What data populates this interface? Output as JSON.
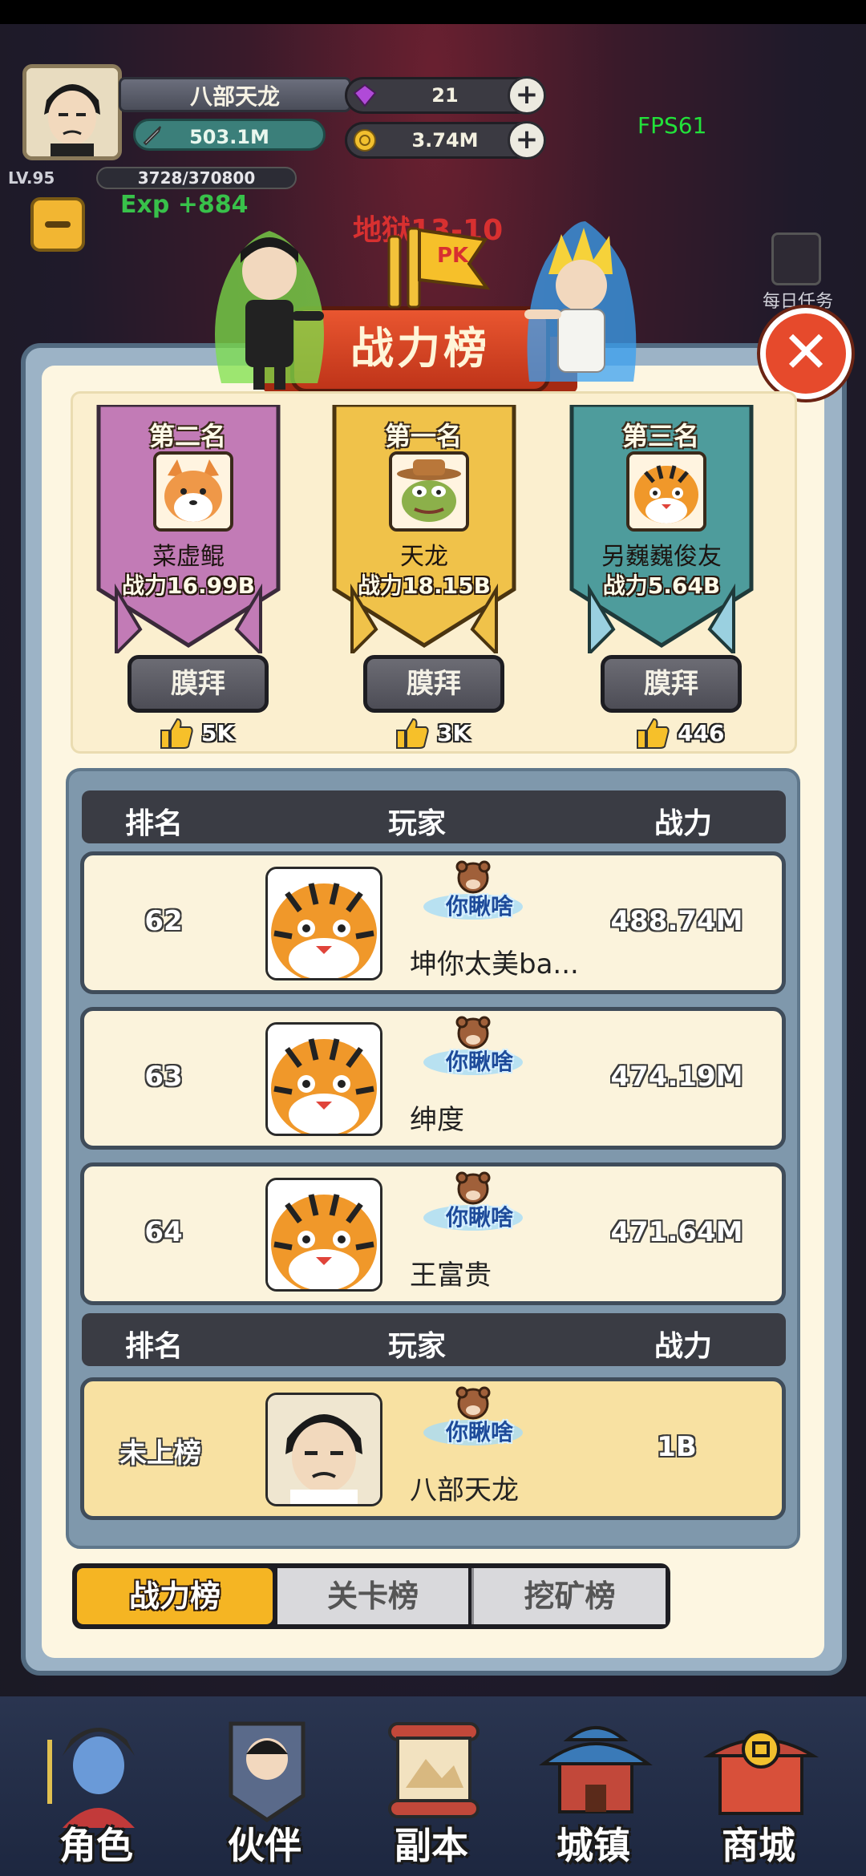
{
  "player": {
    "name": "八部天龙",
    "power": "503.1M",
    "level": "LV.95",
    "exp": "3728/370800",
    "exp_gain": "Exp +884"
  },
  "currency": {
    "gems": "21",
    "coins": "3.74M"
  },
  "fps": "FPS61",
  "stage_text": "地狱13-10",
  "daily_task_label": "每日任务",
  "dialog": {
    "title": "战力榜",
    "close_symbol": "✕",
    "pk_text": "PK"
  },
  "podium": [
    {
      "rank_label": "第二名",
      "name": "菜虚鲲",
      "power": "战力16.99B",
      "worship": "膜拜",
      "likes": "5K",
      "color": "#c27bb6",
      "avatar": "dog"
    },
    {
      "rank_label": "第一名",
      "name": "天龙",
      "power": "战力18.15B",
      "worship": "膜拜",
      "likes": "3K",
      "color": "#f0c24a",
      "avatar": "frog"
    },
    {
      "rank_label": "第三名",
      "name": "另巍巍俊友",
      "power": "战力5.64B",
      "worship": "膜拜",
      "likes": "446",
      "color": "#4e9c9c",
      "avatar": "tiger"
    }
  ],
  "table_headers": {
    "rank": "排名",
    "player": "玩家",
    "power": "战力"
  },
  "rows": [
    {
      "rank": "62",
      "badge": "你瞅啥",
      "name": "坤你太美ba...",
      "power": "488.74M"
    },
    {
      "rank": "63",
      "badge": "你瞅啥",
      "name": "绅度",
      "power": "474.19M"
    },
    {
      "rank": "64",
      "badge": "你瞅啥",
      "name": "王富贵",
      "power": "471.64M"
    }
  ],
  "me_row": {
    "rank": "未上榜",
    "badge": "你瞅啥",
    "name": "八部天龙",
    "power": "1B"
  },
  "tabs": [
    {
      "label": "战力榜",
      "active": true
    },
    {
      "label": "关卡榜",
      "active": false
    },
    {
      "label": "挖矿榜",
      "active": false
    }
  ],
  "bottom_nav": [
    {
      "label": "角色",
      "icon": "character-icon"
    },
    {
      "label": "伙伴",
      "icon": "partner-icon"
    },
    {
      "label": "副本",
      "icon": "dungeon-scroll-icon"
    },
    {
      "label": "城镇",
      "icon": "town-icon"
    },
    {
      "label": "商城",
      "icon": "shop-icon"
    }
  ]
}
